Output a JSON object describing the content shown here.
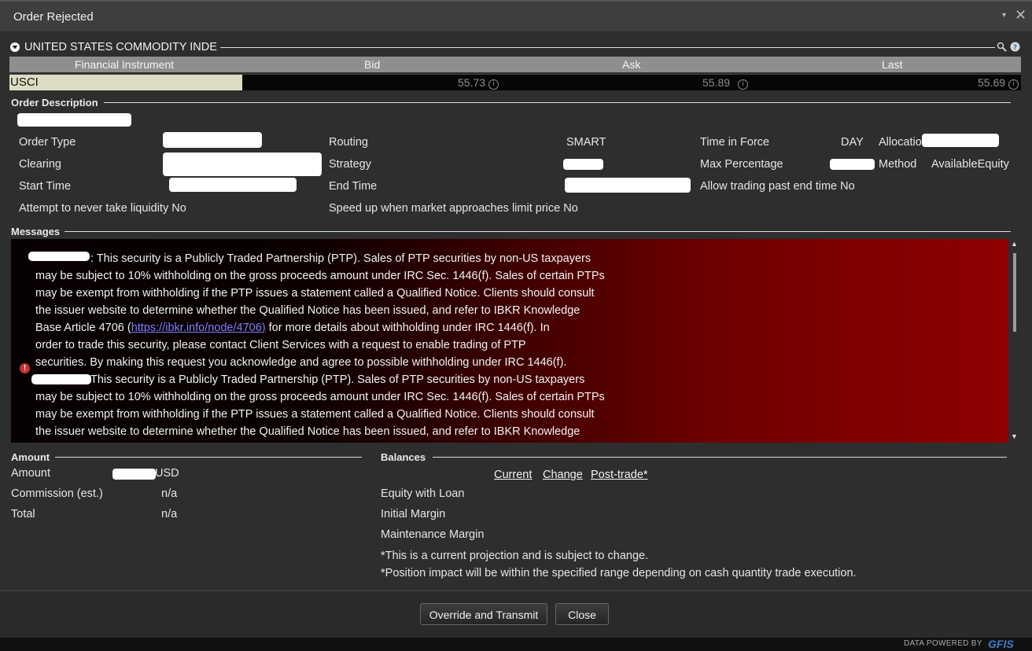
{
  "window": {
    "title": "Order Rejected"
  },
  "instrument": {
    "header": "UNITED STATES COMMODITY INDE",
    "columns": [
      "Financial Instrument",
      "Bid",
      "Ask",
      "Last"
    ],
    "symbol": "USCI",
    "bid": "55.73",
    "ask": "55.89",
    "last": "55.69"
  },
  "order_description": {
    "title": "Order Description",
    "order_type_label": "Order Type",
    "clearing_label": "Clearing",
    "start_time_label": "Start Time",
    "attempt_label": "Attempt to never take liquidity",
    "attempt_value": "No",
    "routing_label": "Routing",
    "routing_value": "SMART",
    "strategy_label": "Strategy",
    "end_time_label": "End Time",
    "speed_label": "Speed up when market approaches limit price",
    "speed_value": "No",
    "tif_label": "Time in Force",
    "tif_value": "DAY",
    "allocation_label": "Allocatio",
    "max_pct_label": "Max Percentage",
    "method_label": "Method",
    "method_value": "AvailableEquity",
    "allow_label": "Allow trading past end time",
    "allow_value": "No"
  },
  "messages": {
    "title": "Messages",
    "lines": [
      ": This security is a Publicly Traded Partnership (PTP). Sales of PTP securities by non-US taxpayers",
      "may be subject to 10% withholding on the gross proceeds amount under IRC Sec. 1446(f). Sales of certain PTPs",
      "may be exempt from withholding if the PTP issues a statement called a Qualified Notice. Clients should consult",
      "the issuer website to determine whether the Qualified Notice has been issued, and refer to IBKR Knowledge",
      "order to trade this security, please contact Client Services with a request to enable trading of PTP",
      "securities. By making this request you acknowledge and agree to possible withholding under IRC 1446(f).",
      " This security is a Publicly Traded Partnership (PTP). Sales of PTP securities by non-US taxpayers",
      "may be subject to 10% withholding on the gross proceeds amount under IRC Sec. 1446(f). Sales of certain PTPs",
      "may be exempt from withholding if the PTP issues a statement called a Qualified Notice. Clients should consult",
      "the issuer website to determine whether the Qualified Notice has been issued, and refer to IBKR Knowledge"
    ],
    "kb_prefix": "Base Article 4706 (",
    "kb_link": "https://ibkr.info/node/4706)",
    "kb_suffix": " for more details about withholding under IRC 1446(f). In"
  },
  "amount": {
    "title": "Amount",
    "amount_label": "Amount",
    "currency": "USD",
    "commission_label": "Commission (est.)",
    "commission_value": "n/a",
    "total_label": "Total",
    "total_value": "n/a"
  },
  "balances": {
    "title": "Balances",
    "tabs": [
      "Current",
      "Change",
      "Post-trade*"
    ],
    "rows": [
      "Equity with Loan",
      "Initial Margin",
      "Maintenance Margin"
    ],
    "note1": "*This is a current projection and is subject to change.",
    "note2": "*Position impact will be within the specified range depending on cash quantity trade execution."
  },
  "buttons": {
    "override": "Override and Transmit",
    "close": "Close"
  },
  "footer": {
    "powered": "DATA POWERED BY",
    "brand": "GFIS"
  }
}
